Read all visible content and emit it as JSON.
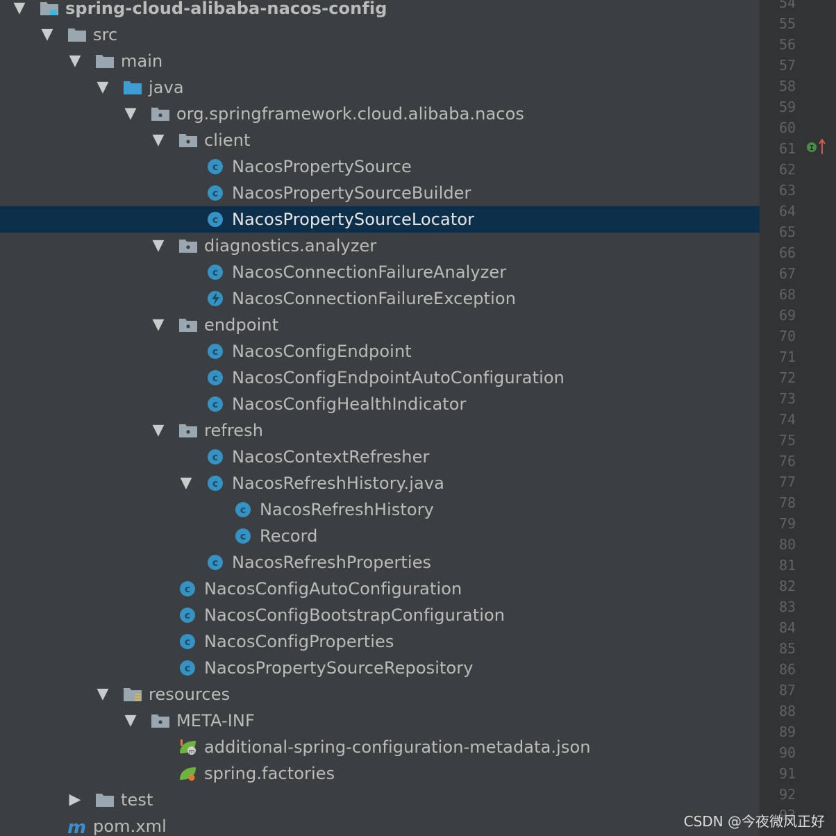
{
  "tree": [
    {
      "depth": 0,
      "arrow": "down",
      "icon": "module-folder",
      "label": "spring-cloud-alibaba-nacos-config",
      "bold": true
    },
    {
      "depth": 1,
      "arrow": "down",
      "icon": "folder",
      "label": "src"
    },
    {
      "depth": 2,
      "arrow": "down",
      "icon": "folder",
      "label": "main"
    },
    {
      "depth": 3,
      "arrow": "down",
      "icon": "source-folder",
      "label": "java"
    },
    {
      "depth": 4,
      "arrow": "down",
      "icon": "package",
      "label": "org.springframework.cloud.alibaba.nacos"
    },
    {
      "depth": 5,
      "arrow": "down",
      "icon": "package",
      "label": "client"
    },
    {
      "depth": 6,
      "arrow": "none",
      "icon": "class",
      "label": "NacosPropertySource"
    },
    {
      "depth": 6,
      "arrow": "none",
      "icon": "class",
      "label": "NacosPropertySourceBuilder"
    },
    {
      "depth": 6,
      "arrow": "none",
      "icon": "class",
      "label": "NacosPropertySourceLocator",
      "selected": true
    },
    {
      "depth": 5,
      "arrow": "down",
      "icon": "package",
      "label": "diagnostics.analyzer"
    },
    {
      "depth": 6,
      "arrow": "none",
      "icon": "class",
      "label": "NacosConnectionFailureAnalyzer"
    },
    {
      "depth": 6,
      "arrow": "none",
      "icon": "exception",
      "label": "NacosConnectionFailureException"
    },
    {
      "depth": 5,
      "arrow": "down",
      "icon": "package",
      "label": "endpoint"
    },
    {
      "depth": 6,
      "arrow": "none",
      "icon": "class",
      "label": "NacosConfigEndpoint"
    },
    {
      "depth": 6,
      "arrow": "none",
      "icon": "class",
      "label": "NacosConfigEndpointAutoConfiguration"
    },
    {
      "depth": 6,
      "arrow": "none",
      "icon": "class",
      "label": "NacosConfigHealthIndicator"
    },
    {
      "depth": 5,
      "arrow": "down",
      "icon": "package",
      "label": "refresh"
    },
    {
      "depth": 6,
      "arrow": "none",
      "icon": "class",
      "label": "NacosContextRefresher"
    },
    {
      "depth": 6,
      "arrow": "down",
      "icon": "class",
      "label": "NacosRefreshHistory.java"
    },
    {
      "depth": 7,
      "arrow": "none",
      "icon": "class",
      "label": "NacosRefreshHistory"
    },
    {
      "depth": 7,
      "arrow": "none",
      "icon": "class",
      "label": "Record"
    },
    {
      "depth": 6,
      "arrow": "none",
      "icon": "class",
      "label": "NacosRefreshProperties"
    },
    {
      "depth": 5,
      "arrow": "none",
      "icon": "class",
      "label": "NacosConfigAutoConfiguration"
    },
    {
      "depth": 5,
      "arrow": "none",
      "icon": "class",
      "label": "NacosConfigBootstrapConfiguration"
    },
    {
      "depth": 5,
      "arrow": "none",
      "icon": "class",
      "label": "NacosConfigProperties"
    },
    {
      "depth": 5,
      "arrow": "none",
      "icon": "class",
      "label": "NacosPropertySourceRepository"
    },
    {
      "depth": 3,
      "arrow": "down",
      "icon": "resources-folder",
      "label": "resources"
    },
    {
      "depth": 4,
      "arrow": "down",
      "icon": "package",
      "label": "META-INF"
    },
    {
      "depth": 5,
      "arrow": "none",
      "icon": "spring-json",
      "label": "additional-spring-configuration-metadata.json"
    },
    {
      "depth": 5,
      "arrow": "none",
      "icon": "spring-factories",
      "label": "spring.factories"
    },
    {
      "depth": 2,
      "arrow": "right",
      "icon": "folder",
      "label": "test"
    },
    {
      "depth": 1,
      "arrow": "none",
      "icon": "maven",
      "label": "pom.xml"
    }
  ],
  "gutter": {
    "line_numbers": [
      "54",
      "55",
      "56",
      "57",
      "58",
      "59",
      "60",
      "61",
      "62",
      "63",
      "64",
      "65",
      "66",
      "67",
      "68",
      "69",
      "70",
      "71",
      "72",
      "73",
      "74",
      "75",
      "76",
      "77",
      "78",
      "79",
      "80",
      "81",
      "82",
      "83",
      "84",
      "85",
      "86",
      "87",
      "88",
      "89",
      "90",
      "91",
      "92",
      "93"
    ],
    "marker_icon": "implements-override-icon"
  },
  "watermark": "CSDN @今夜微风正好"
}
